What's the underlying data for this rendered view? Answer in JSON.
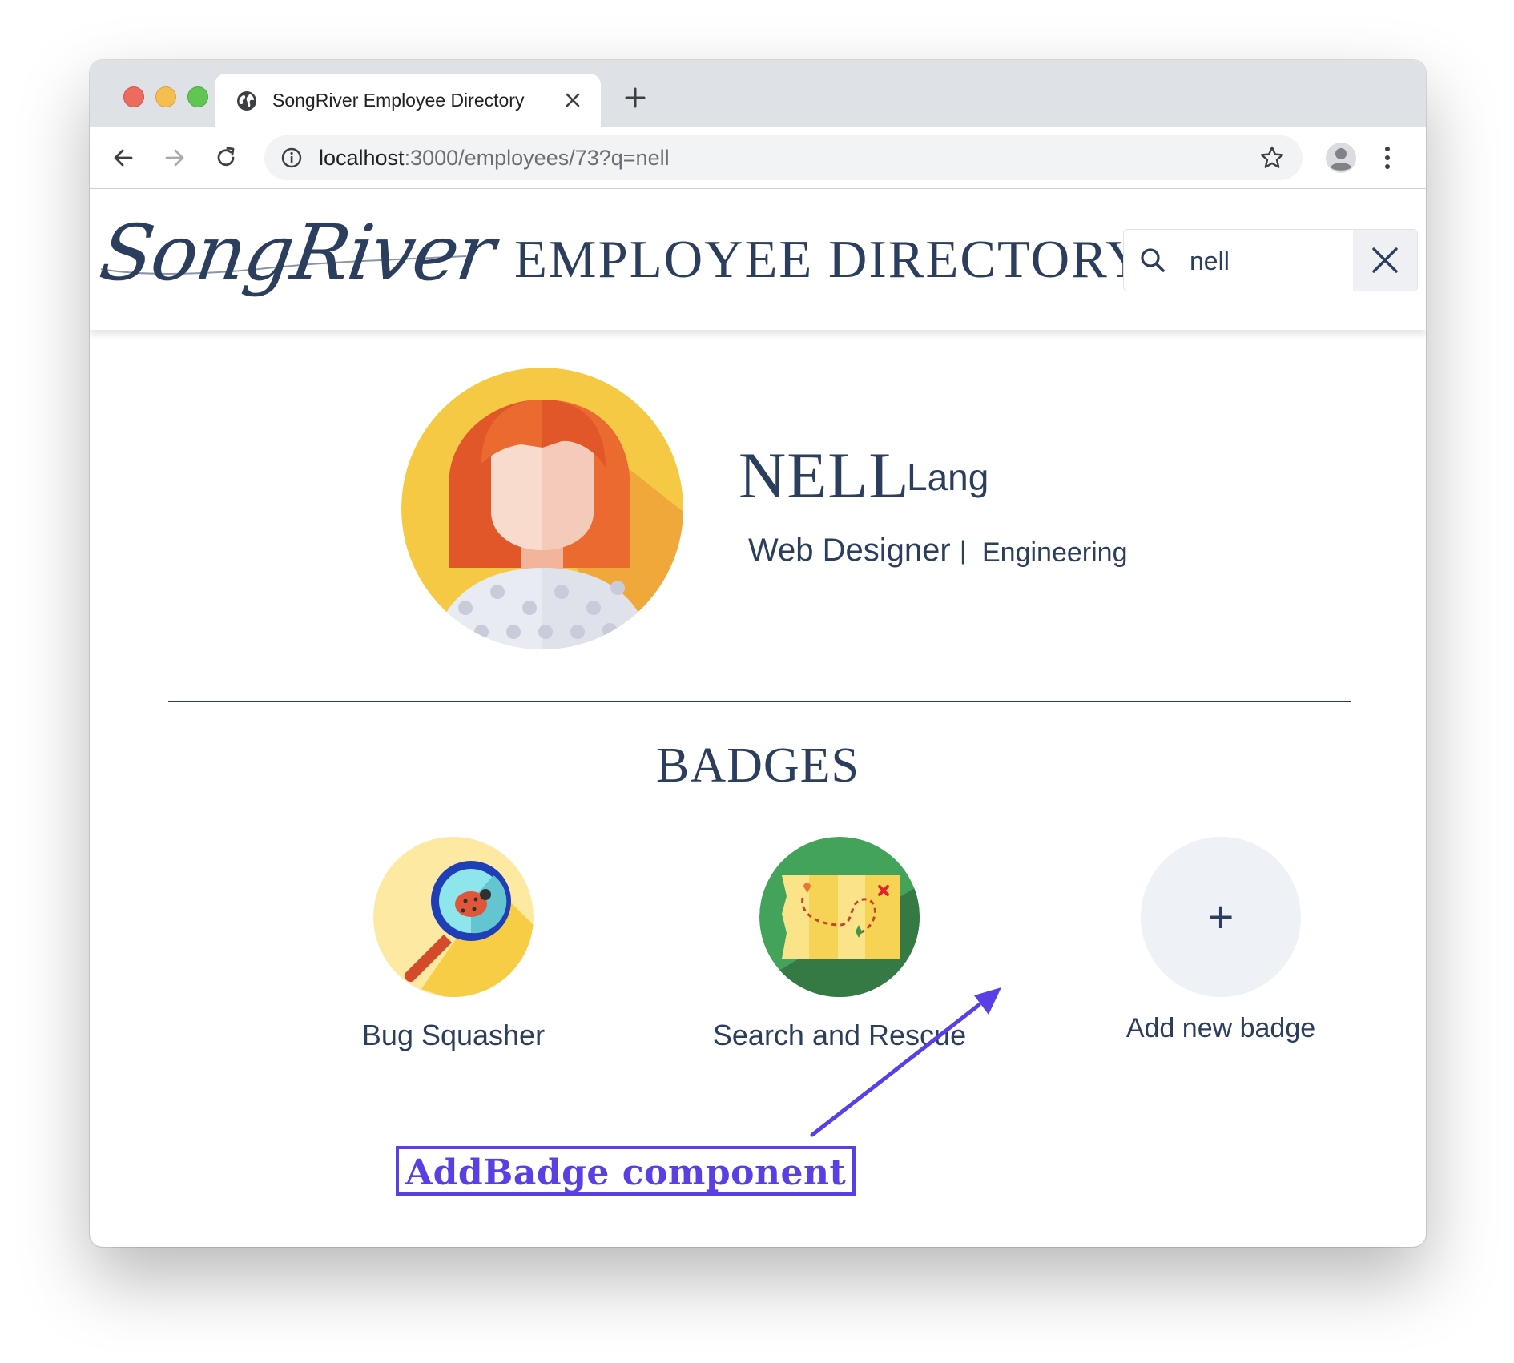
{
  "browser": {
    "tab_title": "SongRiver Employee Directory",
    "url_host": "localhost",
    "url_path": ":3000/employees/73?q=nell"
  },
  "header": {
    "logo_text": "SongRiver",
    "title": "EMPLOYEE DIRECTORY",
    "search_value": "nell"
  },
  "employee": {
    "first_name": "NELL",
    "last_name": "Lang",
    "job_title": "Web Designer",
    "separator": "|",
    "department": "Engineering"
  },
  "badges": {
    "heading": "BADGES",
    "items": [
      {
        "label": "Bug Squasher",
        "icon": "bug-squasher-icon"
      },
      {
        "label": "Search and Rescue",
        "icon": "treasure-map-icon"
      }
    ],
    "add_label": "Add new badge",
    "add_symbol": "+"
  },
  "annotation": {
    "text": "AddBadge component",
    "color": "#5a3ee6"
  },
  "colors": {
    "primary": "#2c3e5e",
    "avatar_bg": "#f6c945",
    "add_badge_bg": "#eef1f5"
  }
}
